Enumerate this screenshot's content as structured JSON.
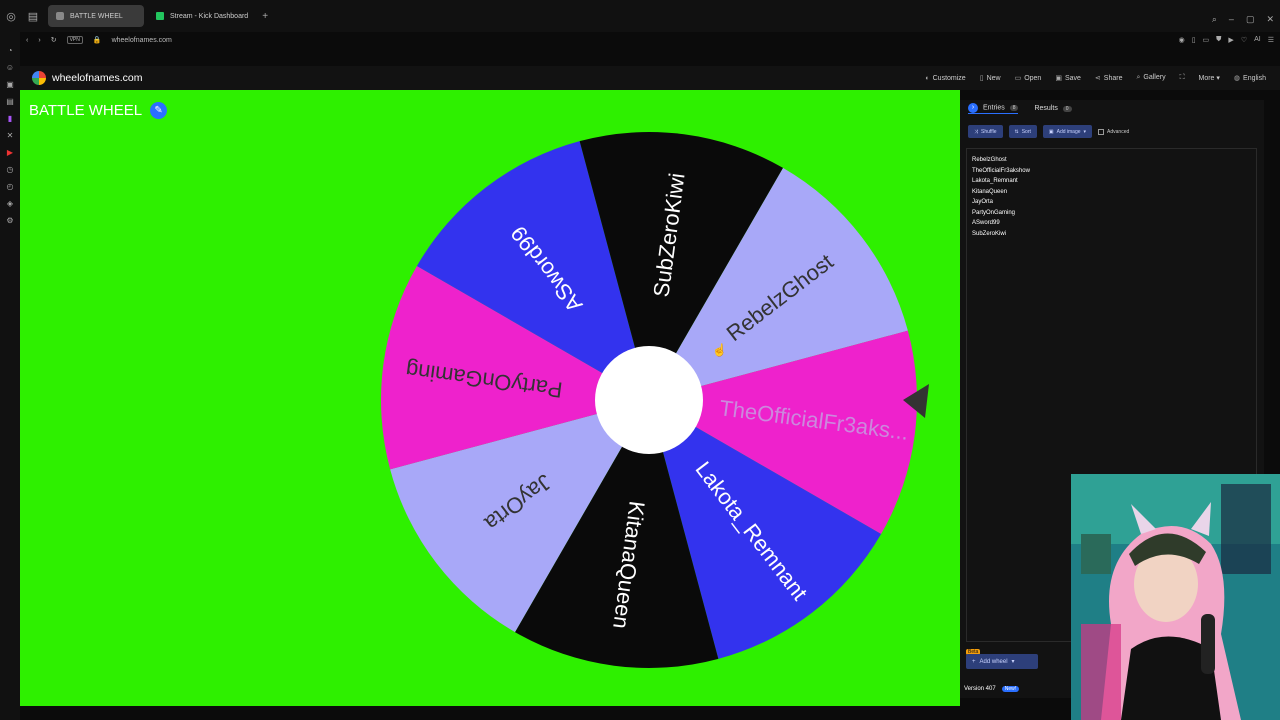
{
  "browser": {
    "tabs": [
      {
        "label": "BATTLE WHEEL",
        "active": true
      },
      {
        "label": "Stream - Kick Dashboard",
        "active": false
      }
    ],
    "vpn_label": "VPN",
    "url": "wheelofnames.com",
    "ai_label": "AI"
  },
  "site": {
    "name": "wheelofnames.com",
    "menu": [
      "Customize",
      "New",
      "Open",
      "Save",
      "Share",
      "Gallery",
      "More",
      "English"
    ]
  },
  "stage": {
    "title": "BATTLE WHEEL",
    "background": "#2ef000"
  },
  "wheel": {
    "segments": [
      {
        "name": "RebelzGhost",
        "color": "#a8a8f8",
        "text_color": "#333333"
      },
      {
        "name": "TheOfficialFr3aks...",
        "color": "#ee22cc",
        "text_color": "#cc88dd"
      },
      {
        "name": "Lakota_Remnant",
        "color": "#3333ee",
        "text_color": "#ffffff"
      },
      {
        "name": "KitanaQueen",
        "color": "#0a0a0a",
        "text_color": "#ffffff"
      },
      {
        "name": "JayOrta",
        "color": "#a8a8f8",
        "text_color": "#333333"
      },
      {
        "name": "PartyOnGaming",
        "color": "#ee22cc",
        "text_color": "#333333"
      },
      {
        "name": "ASword99",
        "color": "#3333ee",
        "text_color": "#ffffff"
      },
      {
        "name": "SubZeroKiwi",
        "color": "#0a0a0a",
        "text_color": "#ffffff"
      }
    ],
    "hub_color": "#ffffff",
    "pointer_color": "#333333"
  },
  "panel": {
    "tabs": [
      {
        "label": "Entries",
        "count": "8"
      },
      {
        "label": "Results",
        "count": "0"
      }
    ],
    "toolbar": {
      "shuffle": "Shuffle",
      "sort": "Sort",
      "add_image": "Add image",
      "advanced": "Advanced"
    },
    "entries": [
      "RebelzGhost",
      "TheOfficialFr3akshow",
      "Lakota_Remnant",
      "KitanaQueen",
      "JayOrta",
      "PartyOnGaming",
      "ASword99",
      "SubZeroKiwi"
    ],
    "beta_label": "Beta",
    "add_wheel": "Add wheel",
    "version": "Version 407",
    "new_badge": "New!"
  }
}
